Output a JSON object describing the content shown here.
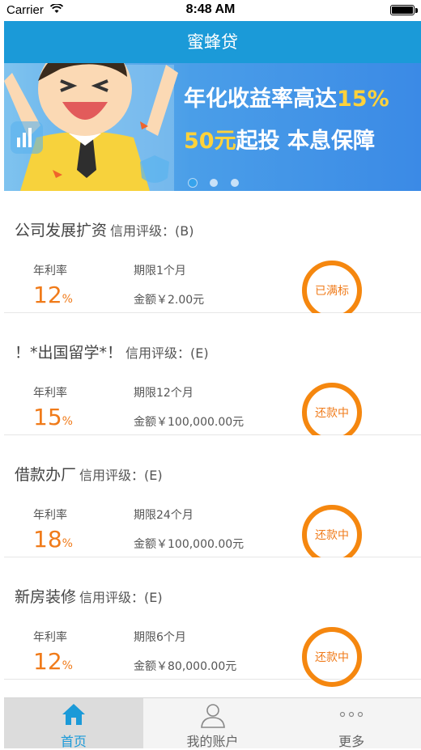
{
  "status_bar": {
    "carrier": "Carrier",
    "time": "8:48 AM"
  },
  "nav": {
    "title": "蜜蜂贷"
  },
  "banner": {
    "line1_text": "年化收益率高达",
    "line1_highlight": "15%",
    "line2_highlight": "50元",
    "line2_text": "起投 本息保障",
    "dots": 3,
    "active_dot": 0
  },
  "loans": [
    {
      "title": "公司发展扩资",
      "rating": "信用评级：(B)",
      "rate_label": "年利率",
      "rate": "12",
      "rate_unit": "%",
      "period": "期限1个月",
      "amount": "金额￥2.00元",
      "status": "已满标"
    },
    {
      "title": "！*出国留学*！",
      "rating": "信用评级：(E)",
      "rate_label": "年利率",
      "rate": "15",
      "rate_unit": "%",
      "period": "期限12个月",
      "amount": "金额￥100,000.00元",
      "status": "还款中"
    },
    {
      "title": "借款办厂",
      "rating": "信用评级：(E)",
      "rate_label": "年利率",
      "rate": "18",
      "rate_unit": "%",
      "period": "期限24个月",
      "amount": "金额￥100,000.00元",
      "status": "还款中"
    },
    {
      "title": "新房装修",
      "rating": "信用评级：(E)",
      "rate_label": "年利率",
      "rate": "12",
      "rate_unit": "%",
      "period": "期限6个月",
      "amount": "金额￥80,000.00元",
      "status": "还款中"
    }
  ],
  "tabs": [
    {
      "label": "首页",
      "icon": "home-icon",
      "active": true
    },
    {
      "label": "我的账户",
      "icon": "user-icon",
      "active": false
    },
    {
      "label": "更多",
      "icon": "more-icon",
      "active": false
    }
  ],
  "colors": {
    "brand": "#1b9ad8",
    "accent": "#f07b1a"
  }
}
